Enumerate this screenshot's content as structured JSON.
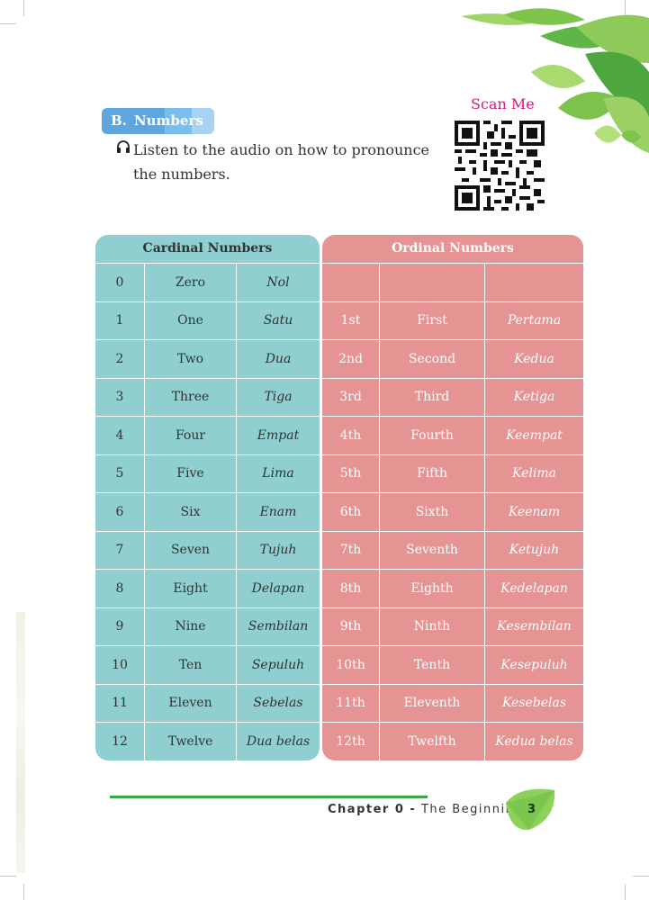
{
  "qr": {
    "label": "Scan Me"
  },
  "section": {
    "letter": "B.",
    "title": "Numbers"
  },
  "instruction": "Listen to the audio on how to pronounce the numbers.",
  "cardinal": {
    "header": "Cardinal Numbers",
    "rows": [
      [
        "0",
        "Zero",
        "Nol"
      ],
      [
        "1",
        "One",
        "Satu"
      ],
      [
        "2",
        "Two",
        "Dua"
      ],
      [
        "3",
        "Three",
        "Tiga"
      ],
      [
        "4",
        "Four",
        "Empat"
      ],
      [
        "5",
        "Five",
        "Lima"
      ],
      [
        "6",
        "Six",
        "Enam"
      ],
      [
        "7",
        "Seven",
        "Tujuh"
      ],
      [
        "8",
        "Eight",
        "Delapan"
      ],
      [
        "9",
        "Nine",
        "Sembilan"
      ],
      [
        "10",
        "Ten",
        "Sepuluh"
      ],
      [
        "11",
        "Eleven",
        "Sebelas"
      ],
      [
        "12",
        "Twelve",
        "Dua belas"
      ]
    ]
  },
  "ordinal": {
    "header": "Ordinal Numbers",
    "rows": [
      [
        "",
        "",
        ""
      ],
      [
        "1st",
        "First",
        "Pertama"
      ],
      [
        "2nd",
        "Second",
        "Kedua"
      ],
      [
        "3rd",
        "Third",
        "Ketiga"
      ],
      [
        "4th",
        "Fourth",
        "Keempat"
      ],
      [
        "5th",
        "Fifth",
        "Kelima"
      ],
      [
        "6th",
        "Sixth",
        "Keenam"
      ],
      [
        "7th",
        "Seventh",
        "Ketujuh"
      ],
      [
        "8th",
        "Eighth",
        "Kedelapan"
      ],
      [
        "9th",
        "Ninth",
        "Kesembilan"
      ],
      [
        "10th",
        "Tenth",
        "Kesepuluh"
      ],
      [
        "11th",
        "Eleventh",
        "Kesebelas"
      ],
      [
        "12th",
        "Twelfth",
        "Kedua belas"
      ]
    ]
  },
  "footer": {
    "chapter": "Chapter 0 -",
    "title": "The Beginning",
    "page": "3"
  },
  "colors": {
    "cardinal": "#8fcfd0",
    "ordinal": "#e59393",
    "accent_green": "#3aa545",
    "scan_label": "#d6177b",
    "tab": "#5fa6df"
  },
  "icons": {
    "audio": "headphones-icon",
    "qr": "qr-code",
    "decor": "leaves-decoration"
  }
}
